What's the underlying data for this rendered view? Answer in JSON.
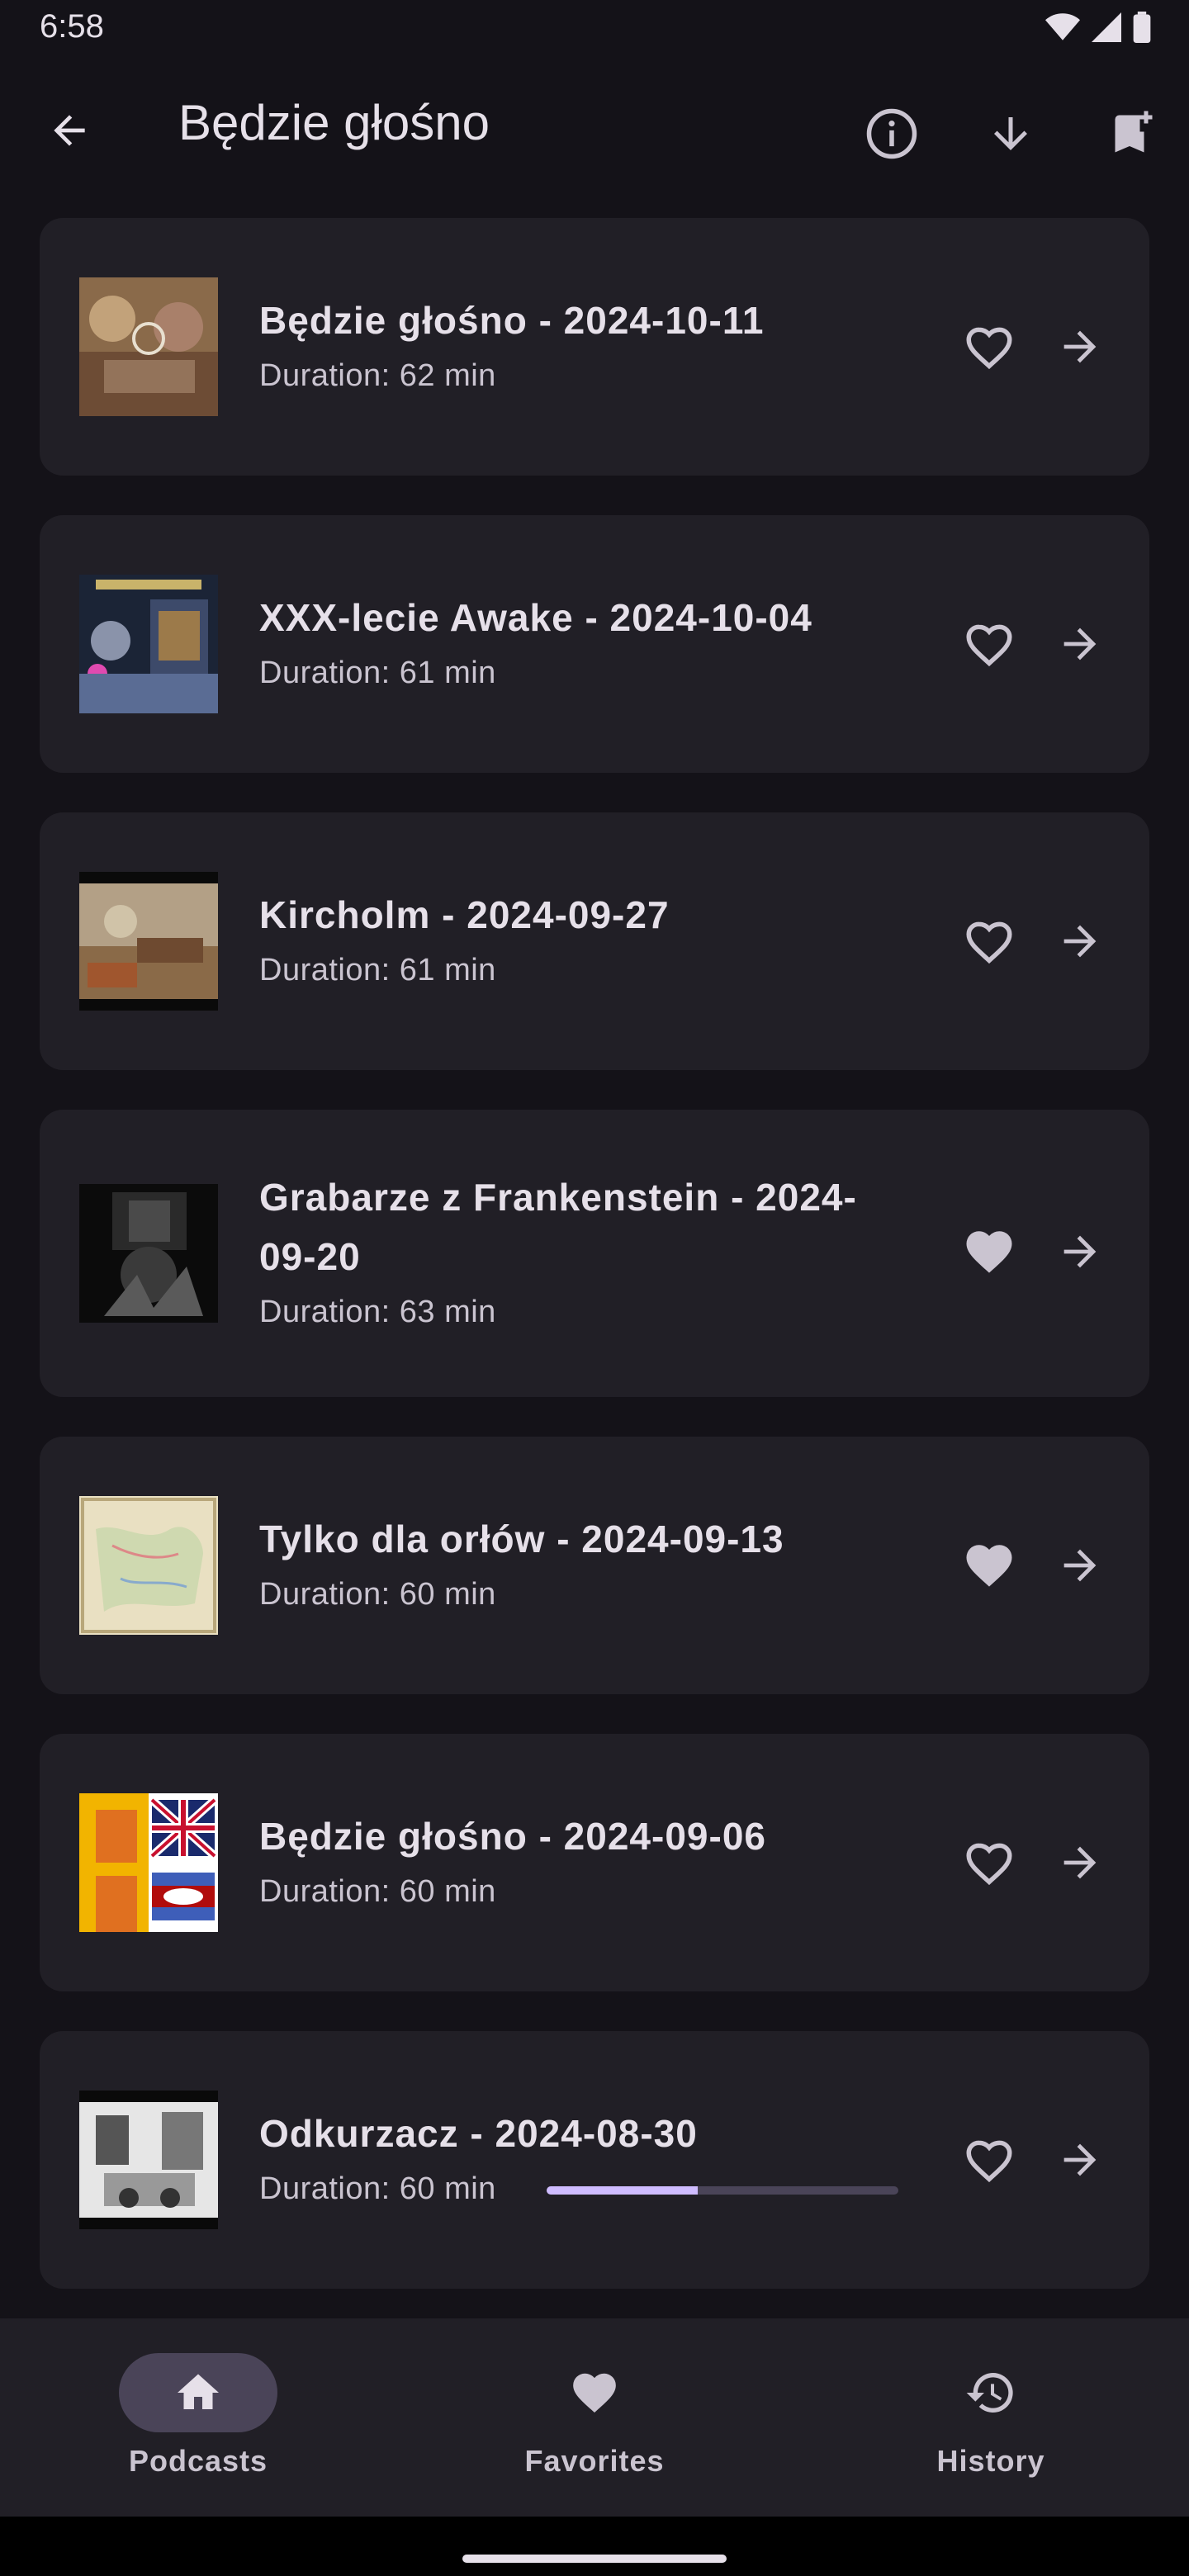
{
  "status_bar": {
    "time": "6:58"
  },
  "app_bar": {
    "title": "Będzie głośno"
  },
  "episodes": [
    {
      "title": "Będzie głośno - 2024-10-11",
      "duration": "Duration: 62 min",
      "favorite": false
    },
    {
      "title": "XXX-lecie Awake - 2024-10-04",
      "duration": "Duration: 61 min",
      "favorite": false
    },
    {
      "title": "Kircholm - 2024-09-27",
      "duration": "Duration: 61 min",
      "favorite": false
    },
    {
      "title": "Grabarze z Frankenstein - 2024-09-20",
      "duration": "Duration: 63 min",
      "favorite": true
    },
    {
      "title": "Tylko dla orłów - 2024-09-13",
      "duration": "Duration: 60 min",
      "favorite": true
    },
    {
      "title": "Będzie głośno - 2024-09-06",
      "duration": "Duration: 60 min",
      "favorite": false
    },
    {
      "title": "Odkurzacz - 2024-08-30",
      "duration": "Duration: 60 min",
      "favorite": false,
      "progress": 0.43
    }
  ],
  "nav": {
    "podcasts": "Podcasts",
    "favorites": "Favorites",
    "history": "History"
  },
  "colors": {
    "background": "#141218",
    "card": "#211f26",
    "accent": "#cfbcff",
    "nav_active": "#4a4458"
  }
}
